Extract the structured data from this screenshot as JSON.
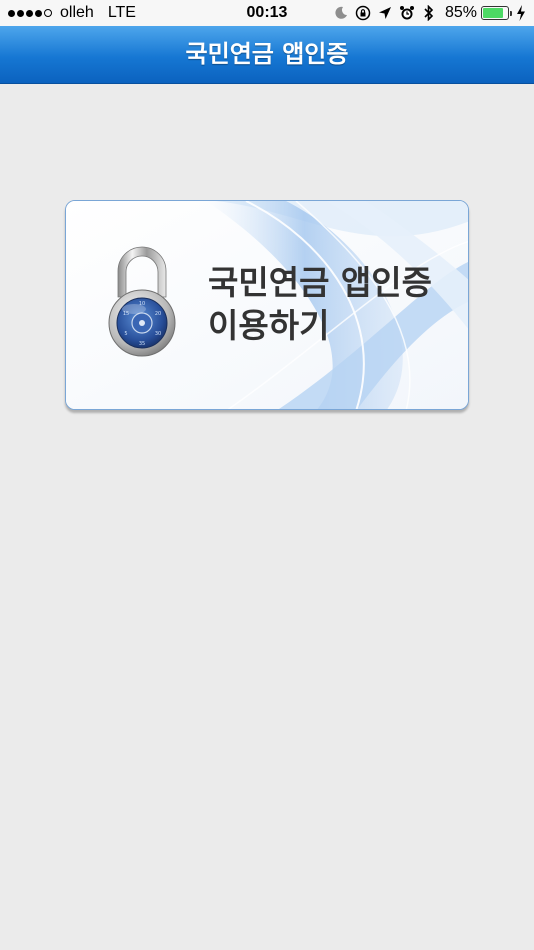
{
  "status_bar": {
    "carrier": "olleh",
    "network": "LTE",
    "time": "00:13",
    "battery_percent": "85%",
    "battery_level": 0.85,
    "icons": [
      "moon-icon",
      "rotation-lock-icon",
      "location-icon",
      "alarm-icon",
      "bluetooth-icon",
      "charging-icon"
    ]
  },
  "header": {
    "title": "국민연금 앱인증"
  },
  "card": {
    "line1": "국민연금 앱인증",
    "line2": "이용하기",
    "icon": "padlock-icon"
  },
  "colors": {
    "header_top": "#4ea6ec",
    "header_bottom": "#0b62bf",
    "background": "#ebebeb",
    "card_border": "#7aa6d6",
    "battery": "#4cd964"
  }
}
